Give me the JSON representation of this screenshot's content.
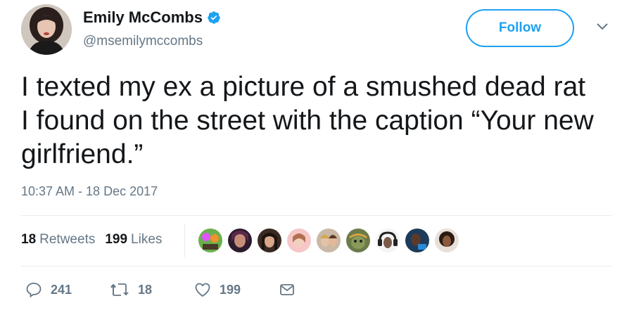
{
  "user": {
    "display_name": "Emily McCombs",
    "handle": "@msemilymccombs",
    "verified_icon": "verified-badge-icon"
  },
  "header": {
    "follow_label": "Follow",
    "menu_icon": "chevron-down-icon"
  },
  "tweet": {
    "text": "I texted my ex a picture of a smushed dead rat I found on the street with the caption “Your new girlfriend.”",
    "timestamp": "10:37 AM - 18 Dec 2017"
  },
  "stats": {
    "retweets_count": "18",
    "retweets_label": "Retweets",
    "likes_count": "199",
    "likes_label": "Likes"
  },
  "actions": {
    "reply_count": "241",
    "retweet_count": "18",
    "like_count": "199"
  },
  "colors": {
    "accent": "#1da1f2",
    "text": "#14171a",
    "muted": "#657786",
    "divider": "#e6ecf0"
  }
}
